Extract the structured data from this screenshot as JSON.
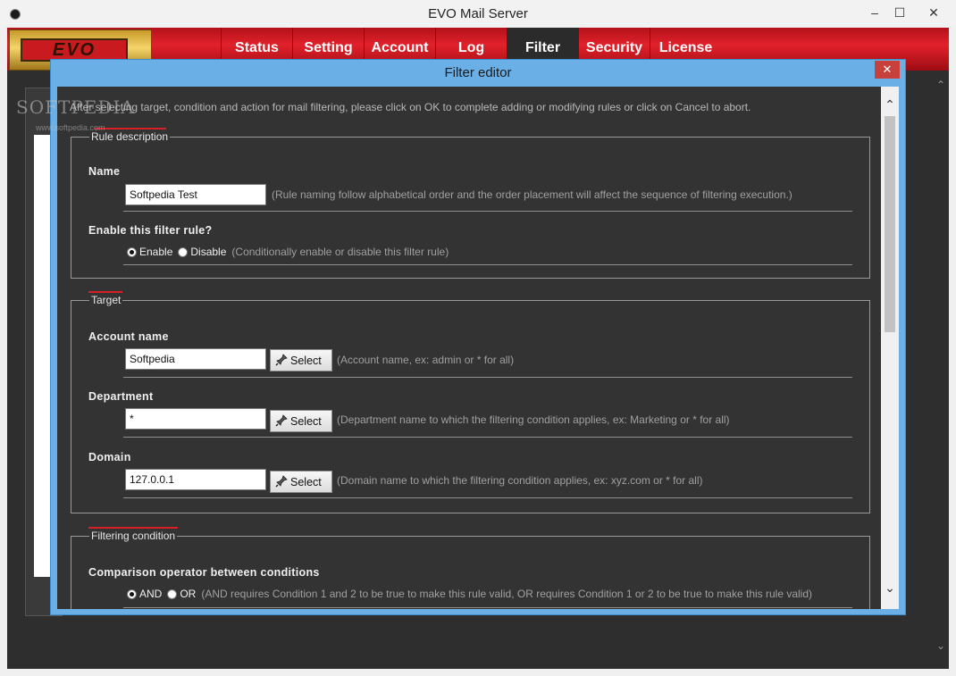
{
  "window": {
    "title": "EVO Mail Server",
    "controls": [
      "–",
      "☐",
      "✕"
    ]
  },
  "logo": {
    "text": "EVO"
  },
  "nav": {
    "tabs": [
      {
        "label": "Status"
      },
      {
        "label": "Setting"
      },
      {
        "label": "Account"
      },
      {
        "label": "Log"
      },
      {
        "label": "Filter",
        "active": true
      },
      {
        "label": "Security"
      },
      {
        "label": "License"
      }
    ]
  },
  "watermark": {
    "text": "SOFTPEDIA",
    "sub": "www.softpedia.com"
  },
  "dialog": {
    "title": "Filter editor",
    "close": "✕",
    "intro": "After selecting target, condition and action for mail filtering, please click on OK to complete adding or modifying rules or click on Cancel to abort.",
    "rule_description": {
      "legend": "Rule description",
      "name_label": "Name",
      "name_value": "Softpedia Test",
      "name_hint": "(Rule naming follow alphabetical order and the order placement will affect the sequence of filtering execution.)",
      "enable_label": "Enable this filter rule?",
      "enable_option": "Enable",
      "disable_option": "Disable",
      "enable_hint": "(Conditionally enable or disable this filter rule)",
      "enabled": true
    },
    "target": {
      "legend": "Target",
      "select_label": "Select",
      "account_label": "Account name",
      "account_value": "Softpedia",
      "account_hint": "(Account name, ex: admin or * for all)",
      "department_label": "Department",
      "department_value": "*",
      "department_hint": "(Department name to which the filtering condition applies, ex: Marketing or * for all)",
      "domain_label": "Domain",
      "domain_value": "127.0.0.1",
      "domain_hint": "(Domain name to which the filtering condition applies, ex: xyz.com or * for all)"
    },
    "filtering_condition": {
      "legend": "Filtering condition",
      "operator_label": "Comparison operator between conditions",
      "and_option": "AND",
      "or_option": "OR",
      "operator_hint": "(AND requires Condition 1 and 2 to be true to make this rule valid, OR requires Condition 1 or 2 to be true to make this rule valid)",
      "selected": "AND"
    }
  },
  "colors": {
    "accent_red": "#d81f26",
    "dialog_border": "#6ab0e6",
    "panel_bg": "#333333"
  }
}
